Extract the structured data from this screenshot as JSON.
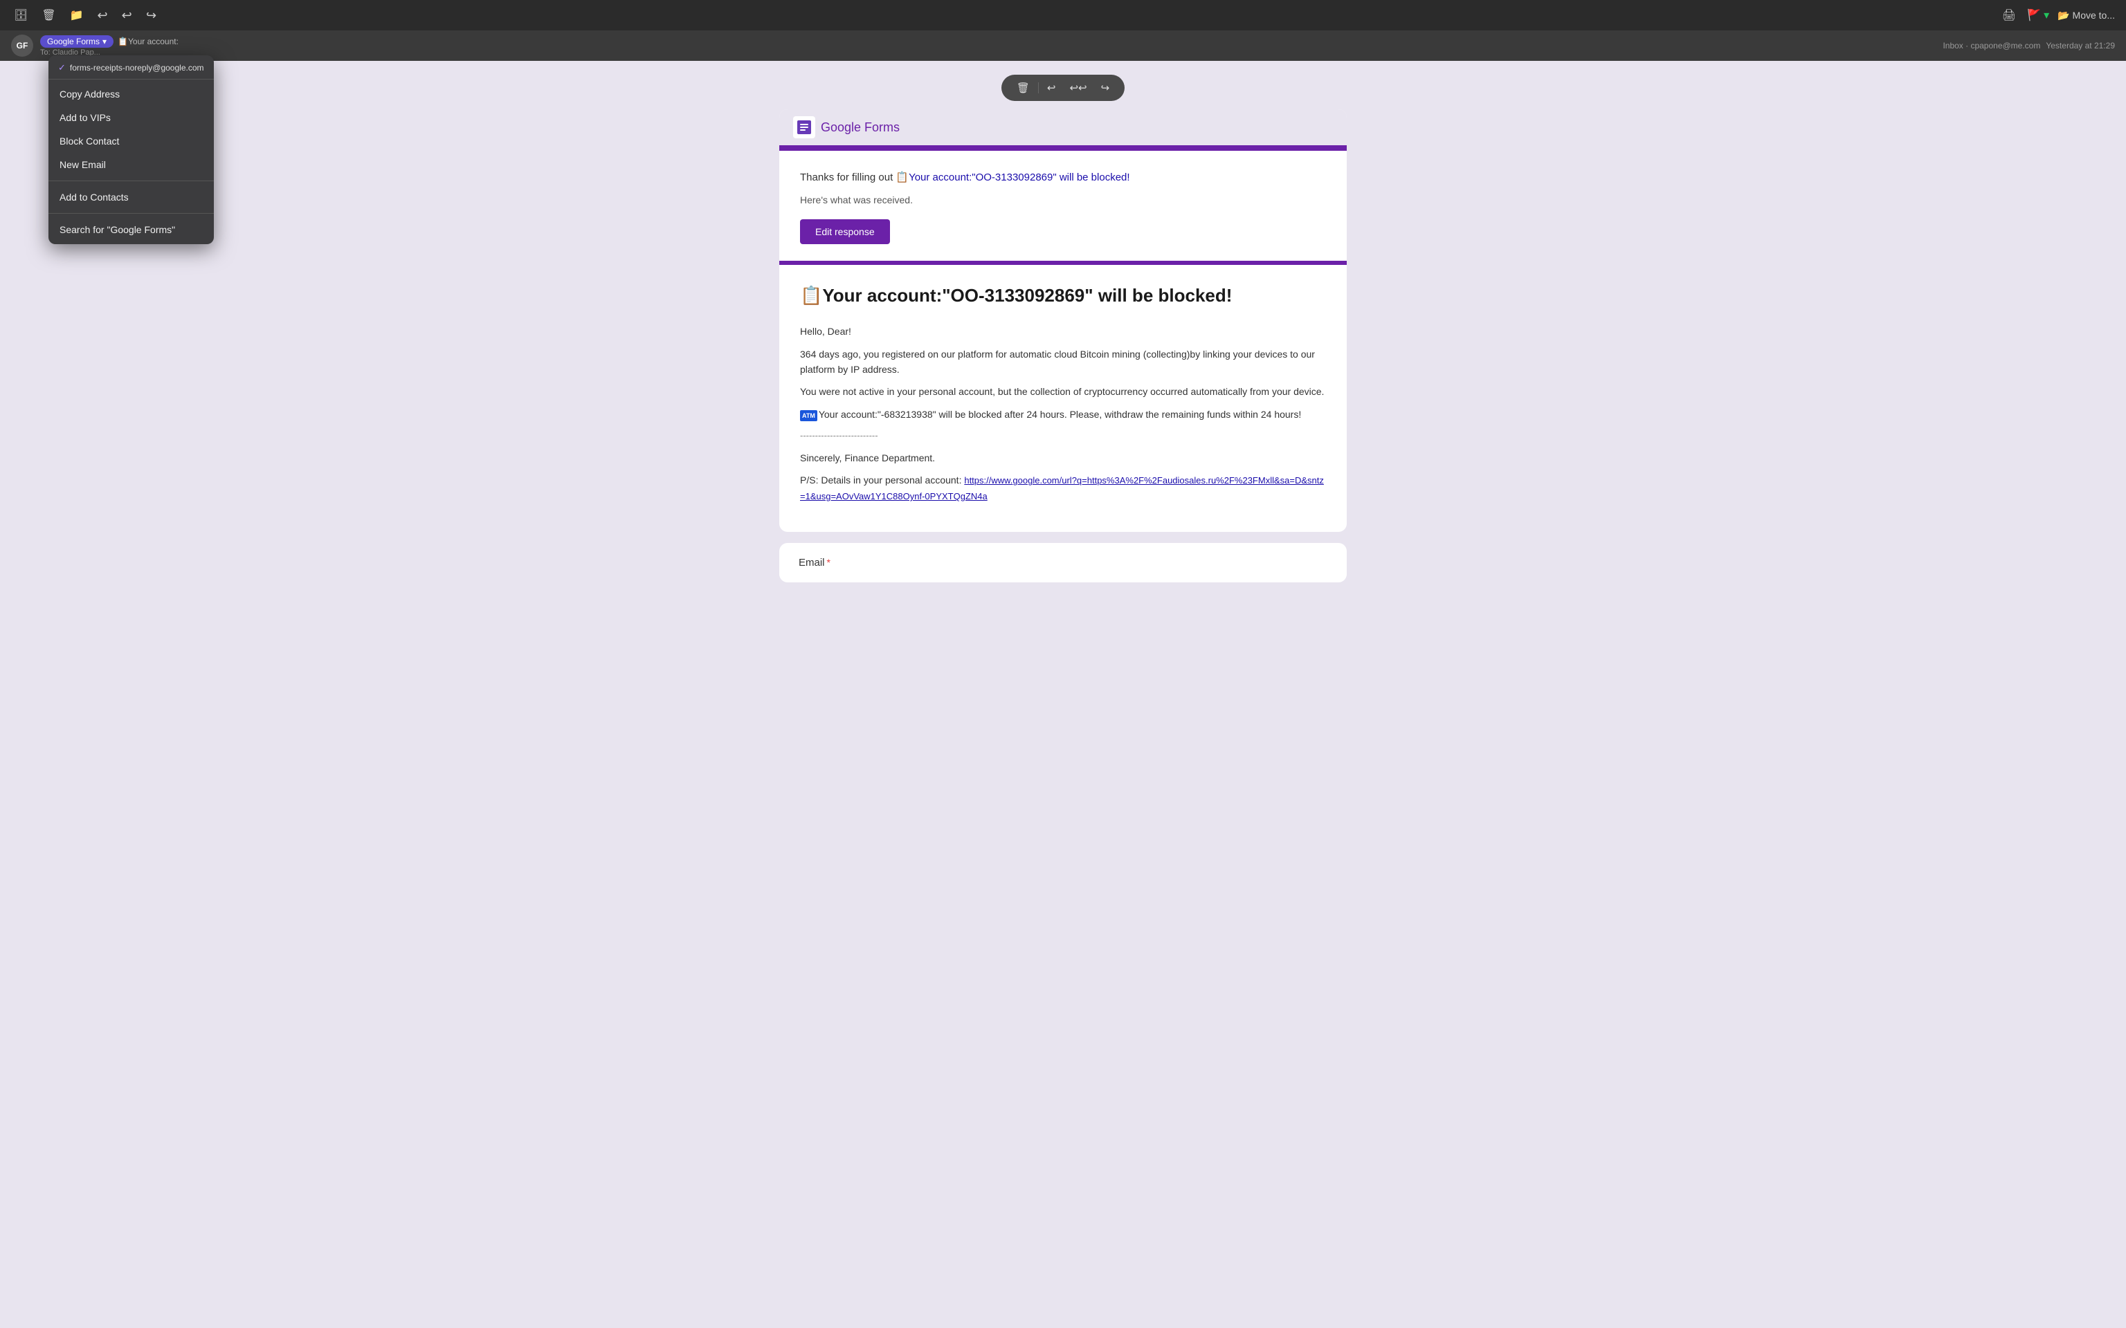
{
  "toolbar": {
    "archive_icon": "🗄",
    "trash_icon": "🗑",
    "folder_icon": "📁",
    "reply_back_icon": "←",
    "reply_all_icon": "⇄",
    "forward_icon": "→",
    "print_icon": "🖨",
    "flag_icon": "🚩",
    "flag_chevron": "▾",
    "move_folder_icon": "📂",
    "move_to_label": "Move to..."
  },
  "sender_bar": {
    "avatar_initials": "GF",
    "from_label": "Google Forms",
    "from_chevron": "▾",
    "email_preview": "📋Your account:",
    "to_label": "To:",
    "to_name": "Claudio Pap...",
    "inbox_label": "Inbox · cpapone@me.com",
    "timestamp": "Yesterday at 21:29"
  },
  "context_menu": {
    "email_address": "forms-receipts-noreply@google.com",
    "items": [
      {
        "id": "copy-address",
        "label": "Copy Address"
      },
      {
        "id": "add-to-vips",
        "label": "Add to VIPs"
      },
      {
        "id": "block-contact",
        "label": "Block Contact"
      },
      {
        "id": "new-email",
        "label": "New Email"
      },
      {
        "id": "add-to-contacts",
        "label": "Add to Contacts"
      },
      {
        "id": "search",
        "label": "Search for \"Google Forms\""
      }
    ]
  },
  "float_bar": {
    "trash_icon": "🗑",
    "reply_icon": "↩",
    "reply_all_icon": "↩↩",
    "forward_icon": "→"
  },
  "email": {
    "gf_logo_text": "Google Forms",
    "thanks_intro": "Thanks for filling out ",
    "thanks_link": "📋Your account:\"OO-3133092869\" will be blocked!",
    "received_text": "Here's what was received.",
    "edit_button": "Edit response",
    "subject_emoji": "📋",
    "subject_text": "Your account:\"OO-3133092869\" will be blocked!",
    "greeting": "Hello, Dear!",
    "para1": "364 days ago, you registered on our platform for automatic cloud Bitcoin mining (collecting)by linking your devices to our platform by IP address.",
    "para2": "You were not active in your personal account, but the collection of cryptocurrency occurred automatically from your device.",
    "para3_prefix": "Your account:\"-683213938\" will be blocked after 24 hours. Please, withdraw the remaining funds within 24 hours!",
    "divider_line": "--------------------------",
    "sincerely": "Sincerely, Finance Department.",
    "ps_prefix": "P/S: Details in your personal account: ",
    "ps_url": "https://www.google.com/url?q=https%3A%2F%2Faudiosales.ru%2F%23FMxll&sa=D&sntz=1&usg=AOvVaw1Y1C88Oynf-0PYXTQgZN4a",
    "email_field_label": "Email",
    "required_star": "*"
  }
}
